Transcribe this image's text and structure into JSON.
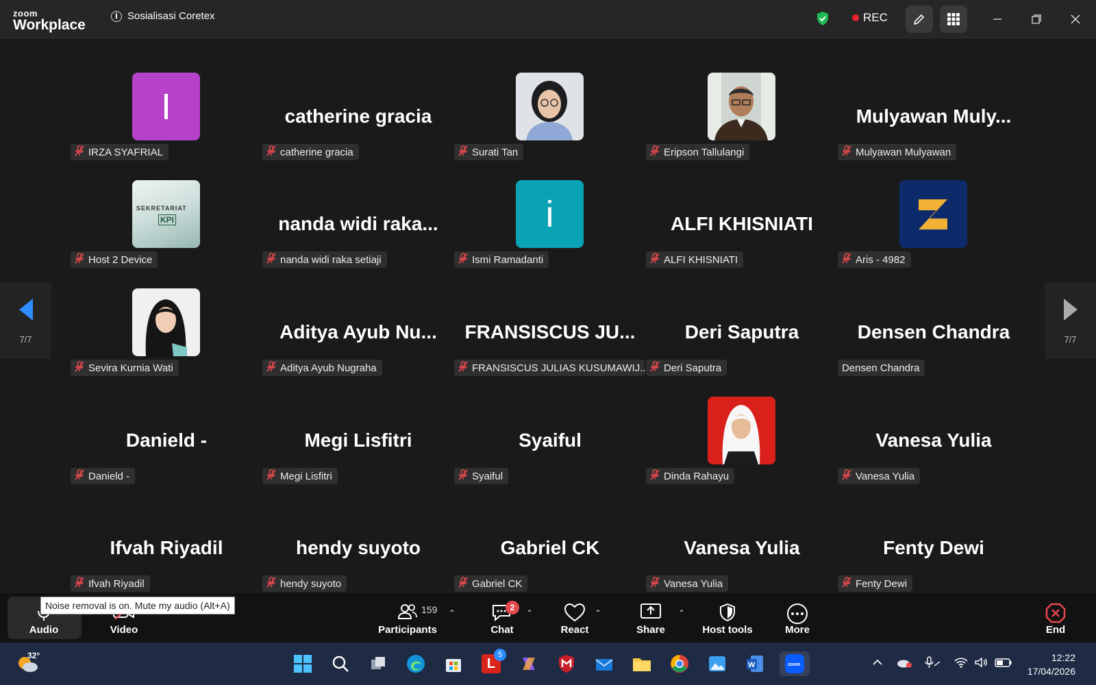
{
  "app": {
    "logo_line1": "zoom",
    "logo_line2": "Workplace",
    "meeting_title": "Sosialisasi Coretex",
    "rec_label": "REC"
  },
  "pagination": {
    "left": "7/7",
    "right": "7/7"
  },
  "tiles": [
    {
      "big": "",
      "tag": "IRZA SYAFRIAL",
      "avatar": "letter-I-purple",
      "muted": true
    },
    {
      "big": "catherine gracia",
      "tag": "catherine gracia",
      "muted": true
    },
    {
      "big": "",
      "tag": "Surati Tan",
      "avatar": "photo-woman-glasses",
      "muted": true
    },
    {
      "big": "",
      "tag": "Eripson Tallulangi",
      "avatar": "photo-man-glasses",
      "muted": true
    },
    {
      "big": "Mulyawan  Muly...",
      "tag": "Mulyawan Mulyawan",
      "muted": true
    },
    {
      "big": "",
      "tag": "Host 2 Device",
      "avatar": "sekretariat-kpi-sign",
      "muted": true
    },
    {
      "big": "nanda  widi  raka...",
      "tag": "nanda widi raka setiaji",
      "muted": true
    },
    {
      "big": "",
      "tag": "Ismi Ramadanti",
      "avatar": "letter-i-teal",
      "muted": true
    },
    {
      "big": "ALFI KHISNIATI",
      "tag": "ALFI KHISNIATI",
      "muted": true
    },
    {
      "big": "",
      "tag": "Aris - 4982",
      "avatar": "logo-navy-yellow",
      "muted": true
    },
    {
      "big": "",
      "tag": "Sevira Kurnia Wati",
      "avatar": "photo-woman-hijab-black",
      "muted": true
    },
    {
      "big": "Aditya  Ayub  Nu...",
      "tag": "Aditya Ayub Nugraha",
      "muted": true
    },
    {
      "big": "FRANSISCUS  JU...",
      "tag": "FRANSISCUS JULIAS KUSUMAWIJ...",
      "muted": true
    },
    {
      "big": "Deri Saputra",
      "tag": "Deri Saputra",
      "muted": true
    },
    {
      "big": "Densen Chandra",
      "tag": "Densen Chandra",
      "muted": false
    },
    {
      "big": "Danield -",
      "tag": "Danield -",
      "muted": true
    },
    {
      "big": "Megi Lisfitri",
      "tag": "Megi Lisfitri",
      "muted": true
    },
    {
      "big": "Syaiful",
      "tag": "Syaiful",
      "muted": true
    },
    {
      "big": "",
      "tag": "Dinda Rahayu",
      "avatar": "photo-woman-hijab-red",
      "muted": true
    },
    {
      "big": "Vanesa Yulia",
      "tag": "Vanesa Yulia",
      "muted": true
    },
    {
      "big": "Ifvah Riyadil",
      "tag": "Ifvah Riyadil",
      "muted": true
    },
    {
      "big": "hendy suyoto",
      "tag": "hendy suyoto",
      "muted": true
    },
    {
      "big": "Gabriel CK",
      "tag": "Gabriel CK",
      "muted": true
    },
    {
      "big": "Vanesa Yulia",
      "tag": "Vanesa Yulia",
      "muted": true
    },
    {
      "big": "Fenty Dewi",
      "tag": "Fenty Dewi",
      "muted": true
    }
  ],
  "avatar_text": {
    "irza": "I",
    "ismi": "i",
    "sekretariat": "SEKRETARIAT",
    "kpi": "KPI"
  },
  "toolbar": {
    "audio": "Audio",
    "video": "Video",
    "participants": "Participants",
    "participants_count": "159",
    "chat": "Chat",
    "chat_badge": "2",
    "react": "React",
    "share": "Share",
    "host_tools": "Host tools",
    "more": "More",
    "end": "End"
  },
  "tooltip": "Noise removal is on. Mute my audio (Alt+A)",
  "taskbar": {
    "temp": "32°",
    "time": "12:22",
    "date": "17/04/2026",
    "outlook_badge": "5"
  },
  "colors": {
    "accent_blue": "#2d8cff",
    "rec_red": "#e8222e",
    "shield_green": "#1db954",
    "mute_red": "#e5484d"
  }
}
